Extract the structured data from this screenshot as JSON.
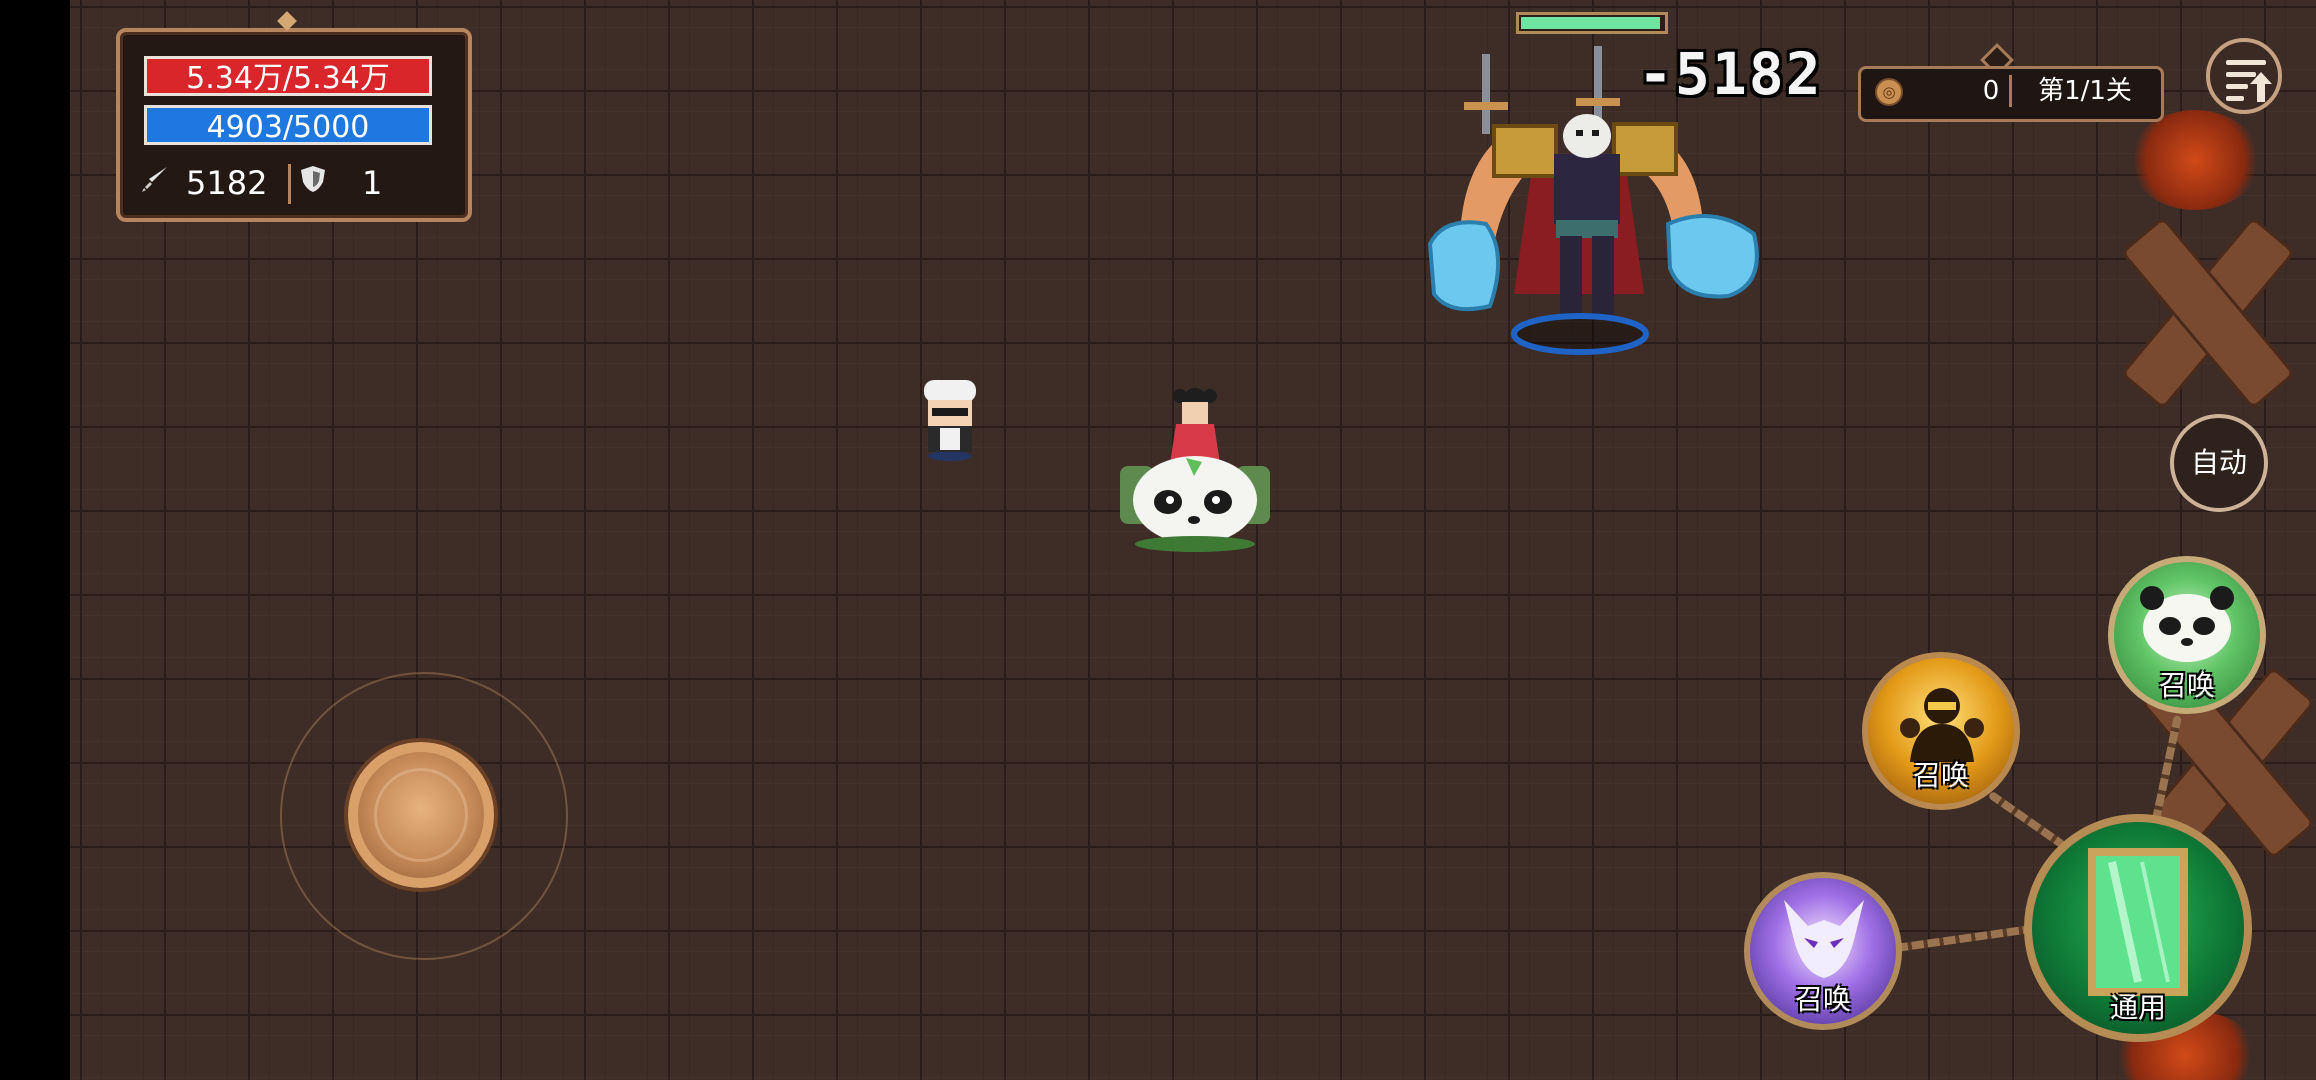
{
  "player_stats": {
    "hp": "5.34万/5.34万",
    "mp": "4903/5000",
    "attack": "5182",
    "defense": "1",
    "attack_icon": "sword-icon",
    "defense_icon": "shield-icon"
  },
  "boss": {
    "hp_fraction": 0.98,
    "damage_text": "-5182"
  },
  "level_info": {
    "coin_icon": "coin-icon",
    "coins": "0",
    "stage": "第1/1关"
  },
  "controls": {
    "menu_icon": "menu-upgrade-icon",
    "auto_label": "自动"
  },
  "skills": [
    {
      "id": "panda",
      "label": "召唤",
      "icon": "panda-summon-icon"
    },
    {
      "id": "fire",
      "label": "召唤",
      "icon": "fire-warrior-summon-icon"
    },
    {
      "id": "demon",
      "label": "召唤",
      "icon": "demon-summon-icon"
    },
    {
      "id": "general",
      "label": "通用",
      "icon": "scroll-icon"
    }
  ],
  "colors": {
    "hp": "#d9262b",
    "mp": "#1e78e0",
    "boss_hp": "#6fe3a0",
    "floor": "#3e2c26",
    "frame": "#b7855d"
  }
}
